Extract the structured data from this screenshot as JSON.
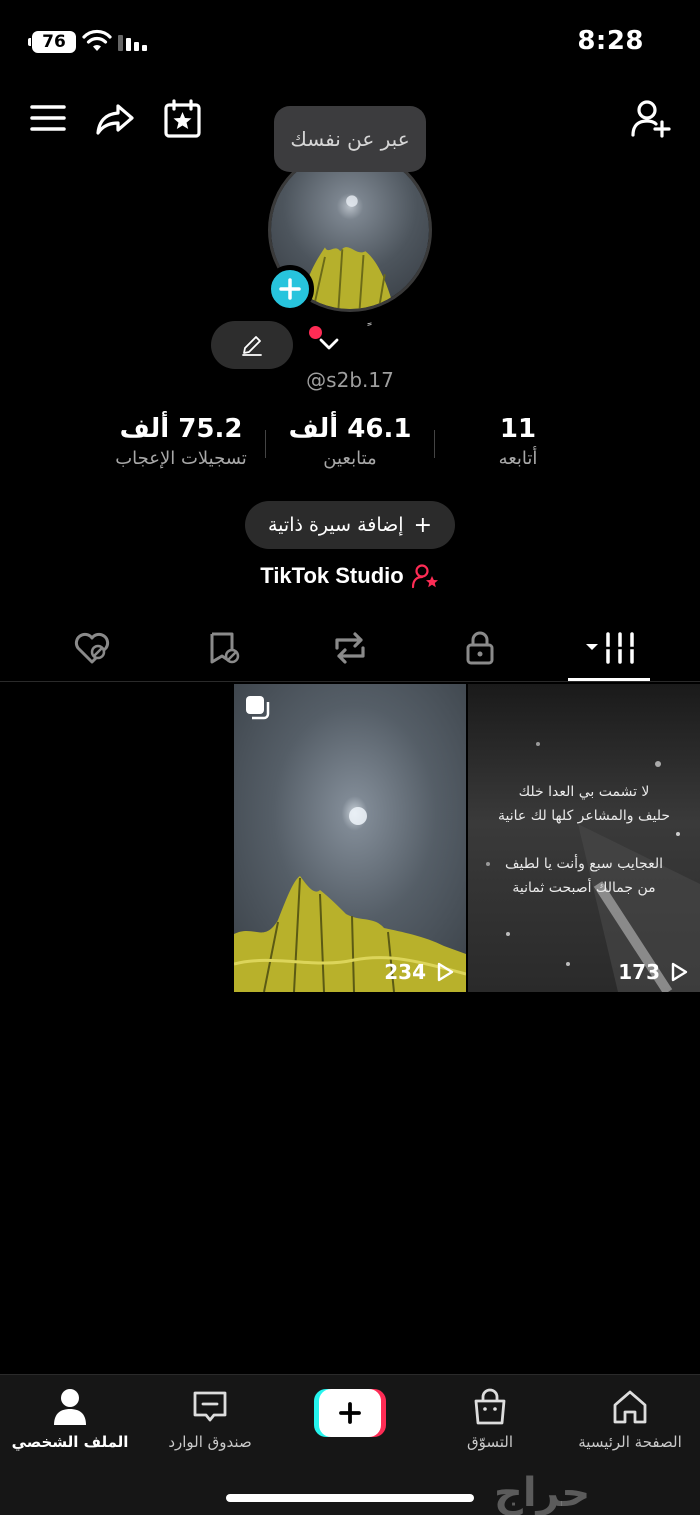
{
  "status_bar": {
    "battery": "76",
    "time": "8:28"
  },
  "header": {
    "icons": [
      "menu-icon",
      "share-icon",
      "calendar-star-icon",
      "add-friend-icon"
    ]
  },
  "profile": {
    "tooltip": "عبر عن نفسك",
    "name_mark": "ً",
    "handle": "@s2b.17",
    "stats": {
      "likes": {
        "value": "75.2 ألف",
        "label": "تسجيلات الإعجاب"
      },
      "followers": {
        "value": "46.1 ألف",
        "label": "متابعين"
      },
      "following": {
        "value": "11",
        "label": "أتابعه"
      }
    },
    "add_bio": "إضافة سيرة ذاتية",
    "studio": "TikTok Studio"
  },
  "tabs": [
    "liked-hidden-icon",
    "favorites-hidden-icon",
    "repost-icon",
    "private-lock-icon",
    "videos-grid-icon"
  ],
  "videos": [
    {
      "views": "234",
      "type": "photo"
    },
    {
      "views": "173",
      "type": "video",
      "lines": [
        "لا تشمت بي العدا خلك",
        "حليف والمشاعر كلها لك عانية",
        "",
        "العجايب سبع وأنت يا لطيف",
        "من جمالك أصبحت ثمانية"
      ]
    }
  ],
  "nav": {
    "profile": "الملف الشخصي",
    "inbox": "صندوق الوارد",
    "shop": "التسوّق",
    "home": "الصفحة الرئيسية"
  },
  "watermark": "حراج",
  "colors": {
    "accent_red": "#fe2c55",
    "accent_cyan": "#25f4ee",
    "avatar_add": "#27c4dd",
    "background": "#000000"
  }
}
